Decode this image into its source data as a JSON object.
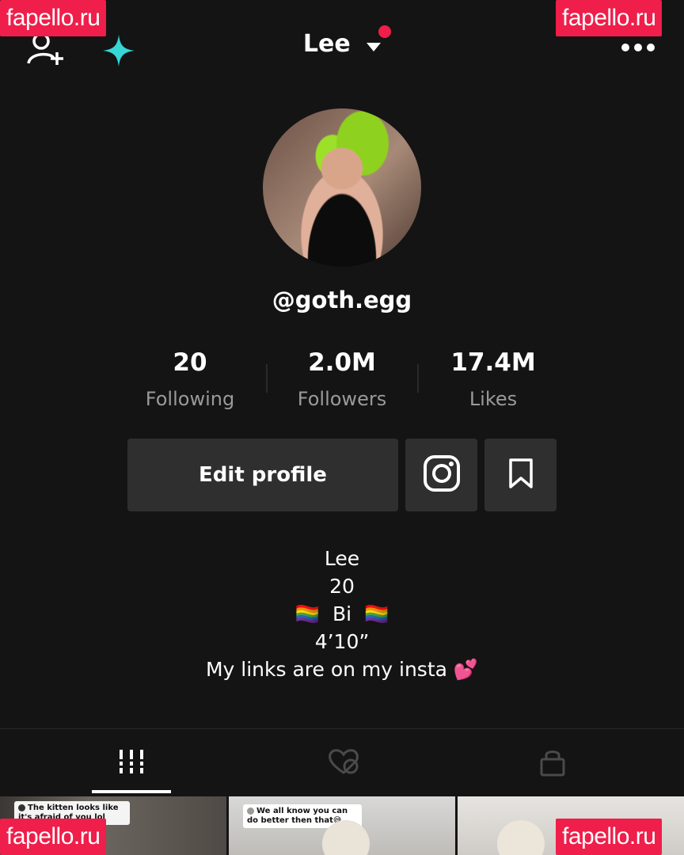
{
  "watermark": "fapello.ru",
  "header": {
    "title": "Lee"
  },
  "profile": {
    "handle": "@goth.egg"
  },
  "stats": [
    {
      "value": "20",
      "label": "Following"
    },
    {
      "value": "2.0M",
      "label": "Followers"
    },
    {
      "value": "17.4M",
      "label": "Likes"
    }
  ],
  "actions": {
    "edit_profile": "Edit profile"
  },
  "bio": {
    "name": "Lee",
    "age": "20",
    "flag": "🏳️‍🌈",
    "orientation": "Bi",
    "height": "4’10”",
    "links": "My links are on my insta 💕"
  },
  "videos": [
    {
      "caption": "The kitten looks like it's afraid of you lol"
    },
    {
      "caption": "We all know you can do better then that😅"
    }
  ],
  "colors": {
    "accent": "#ef1e4a",
    "sparkle": "#36d6d6",
    "button": "#2f2f2f"
  }
}
